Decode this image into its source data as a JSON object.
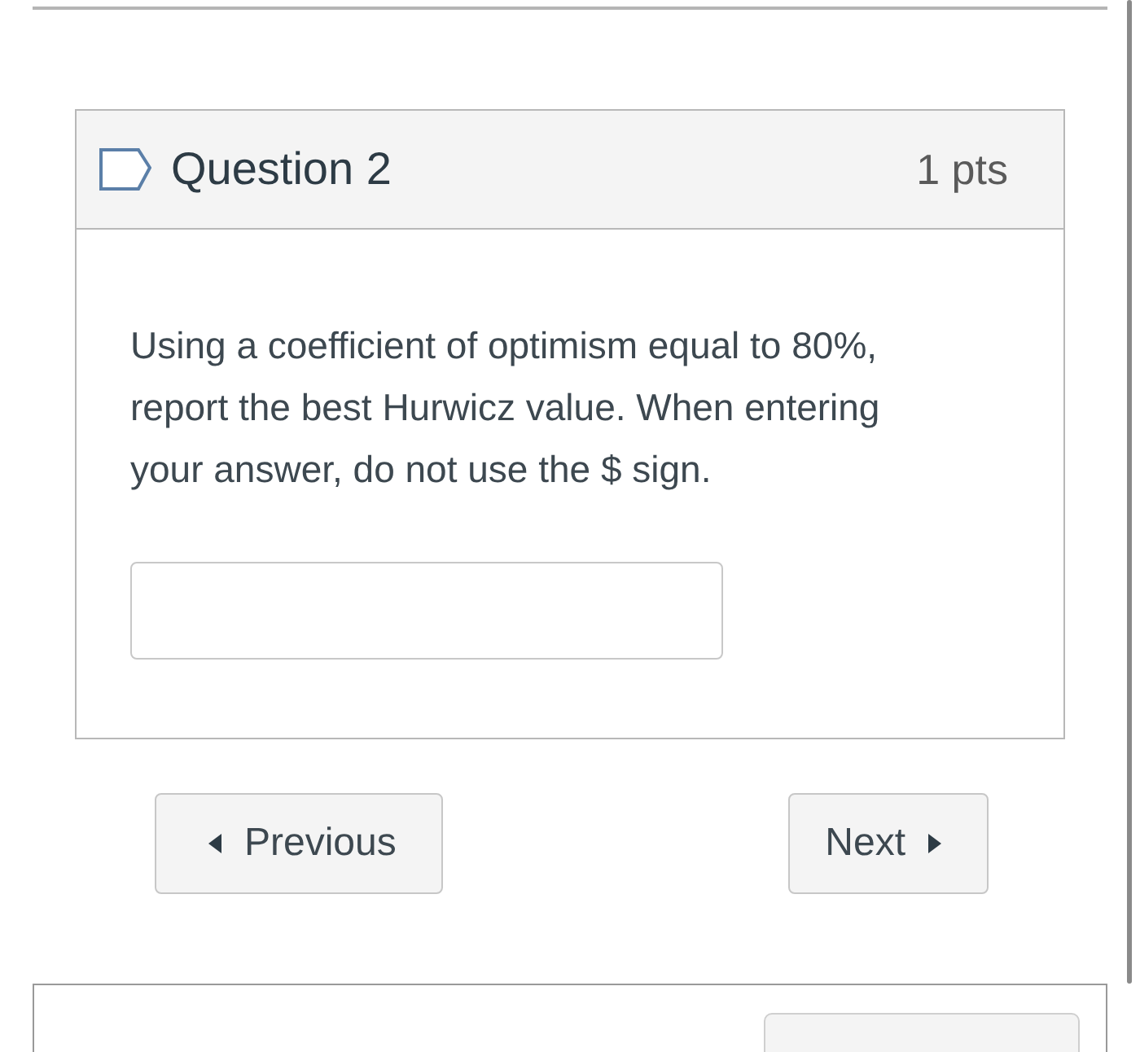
{
  "question": {
    "title": "Question 2",
    "points": "1 pts",
    "text": "Using a coefficient of optimism equal to 80%, report the best Hurwicz value. When entering your answer, do not use the $ sign."
  },
  "navigation": {
    "previous": "Previous",
    "next": "Next"
  }
}
